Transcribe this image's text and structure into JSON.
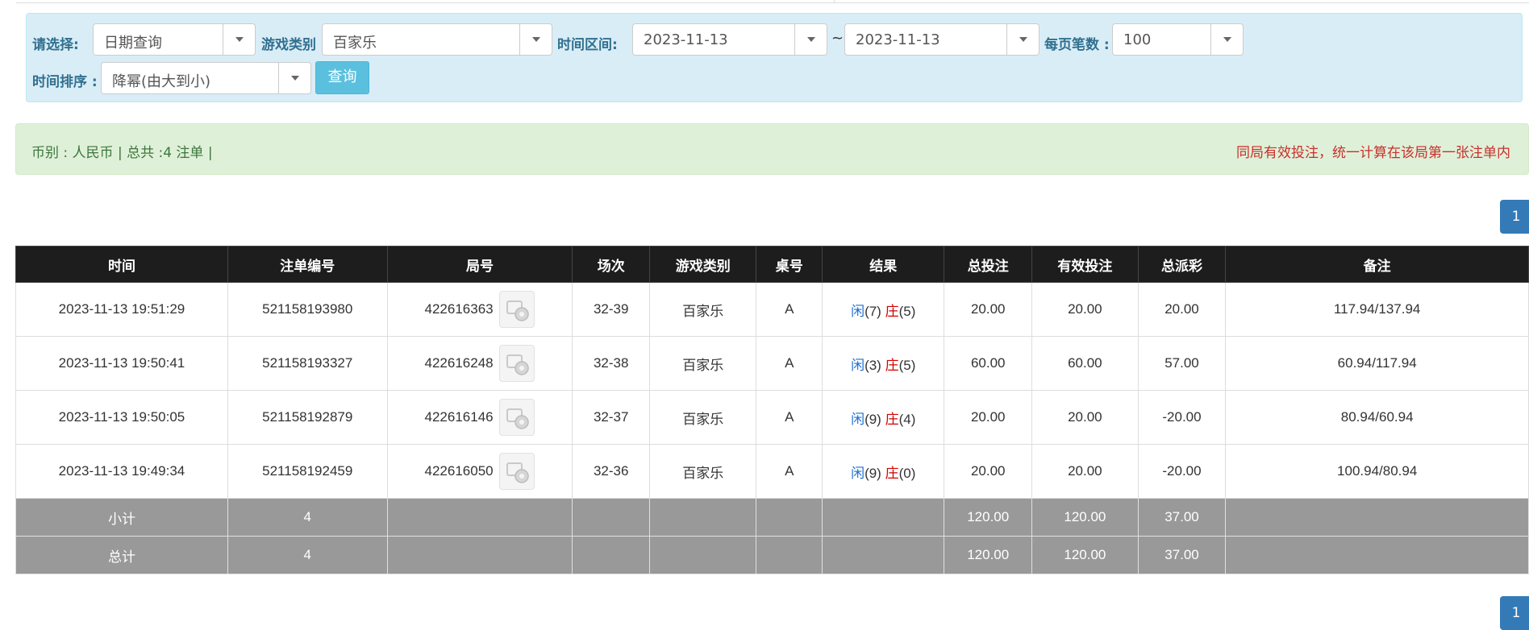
{
  "filters": {
    "select_label": "请选择:",
    "select_value": "日期查询",
    "game_type_label": "游戏类别",
    "game_type_value": "百家乐",
    "time_range_label": "时间区间:",
    "date_from": "2023-11-13",
    "range_sep": "~",
    "date_to": "2023-11-13",
    "page_size_label": "每页笔数 :",
    "page_size_value": "100",
    "sort_label": "时间排序 :",
    "sort_value": "降幂(由大到小)",
    "query_button": "查询"
  },
  "info": {
    "left": "币别 : 人民币 | 总共 :4 注单 |",
    "right": "同局有效投注，统一计算在该局第一张注单内"
  },
  "pagination": {
    "current": "1"
  },
  "table": {
    "headers": [
      "时间",
      "注单编号",
      "局号",
      "场次",
      "游戏类别",
      "桌号",
      "结果",
      "总投注",
      "有效投注",
      "总派彩",
      "备注"
    ],
    "rows": [
      {
        "time": "2023-11-13 19:51:29",
        "bet_no": "521158193980",
        "round": "422616363",
        "session": "32-39",
        "game": "百家乐",
        "table": "A",
        "player_label": "闲",
        "player_val": "(7)",
        "banker_label": "庄",
        "banker_val": "(5)",
        "total_bet": "20.00",
        "valid_bet": "20.00",
        "payout": "20.00",
        "remark": "117.94/137.94"
      },
      {
        "time": "2023-11-13 19:50:41",
        "bet_no": "521158193327",
        "round": "422616248",
        "session": "32-38",
        "game": "百家乐",
        "table": "A",
        "player_label": "闲",
        "player_val": "(3)",
        "banker_label": "庄",
        "banker_val": "(5)",
        "total_bet": "60.00",
        "valid_bet": "60.00",
        "payout": "57.00",
        "remark": "60.94/117.94"
      },
      {
        "time": "2023-11-13 19:50:05",
        "bet_no": "521158192879",
        "round": "422616146",
        "session": "32-37",
        "game": "百家乐",
        "table": "A",
        "player_label": "闲",
        "player_val": "(9)",
        "banker_label": "庄",
        "banker_val": "(4)",
        "total_bet": "20.00",
        "valid_bet": "20.00",
        "payout": "-20.00",
        "remark": "80.94/60.94"
      },
      {
        "time": "2023-11-13 19:49:34",
        "bet_no": "521158192459",
        "round": "422616050",
        "session": "32-36",
        "game": "百家乐",
        "table": "A",
        "player_label": "闲",
        "player_val": "(9)",
        "banker_label": "庄",
        "banker_val": "(0)",
        "total_bet": "20.00",
        "valid_bet": "20.00",
        "payout": "-20.00",
        "remark": "100.94/80.94"
      }
    ],
    "subtotal": {
      "label": "小计",
      "count": "4",
      "total_bet": "120.00",
      "valid_bet": "120.00",
      "payout": "37.00"
    },
    "total": {
      "label": "总计",
      "count": "4",
      "total_bet": "120.00",
      "valid_bet": "120.00",
      "payout": "37.00"
    }
  },
  "colors": {
    "filter_bg": "#d9edf7",
    "info_bg": "#dff0d8",
    "header_bg": "#1d1d1d",
    "summary_bg": "#999999",
    "accent_blue": "#337ab7",
    "query_button": "#5bc0de",
    "negative_red": "#d20000"
  }
}
